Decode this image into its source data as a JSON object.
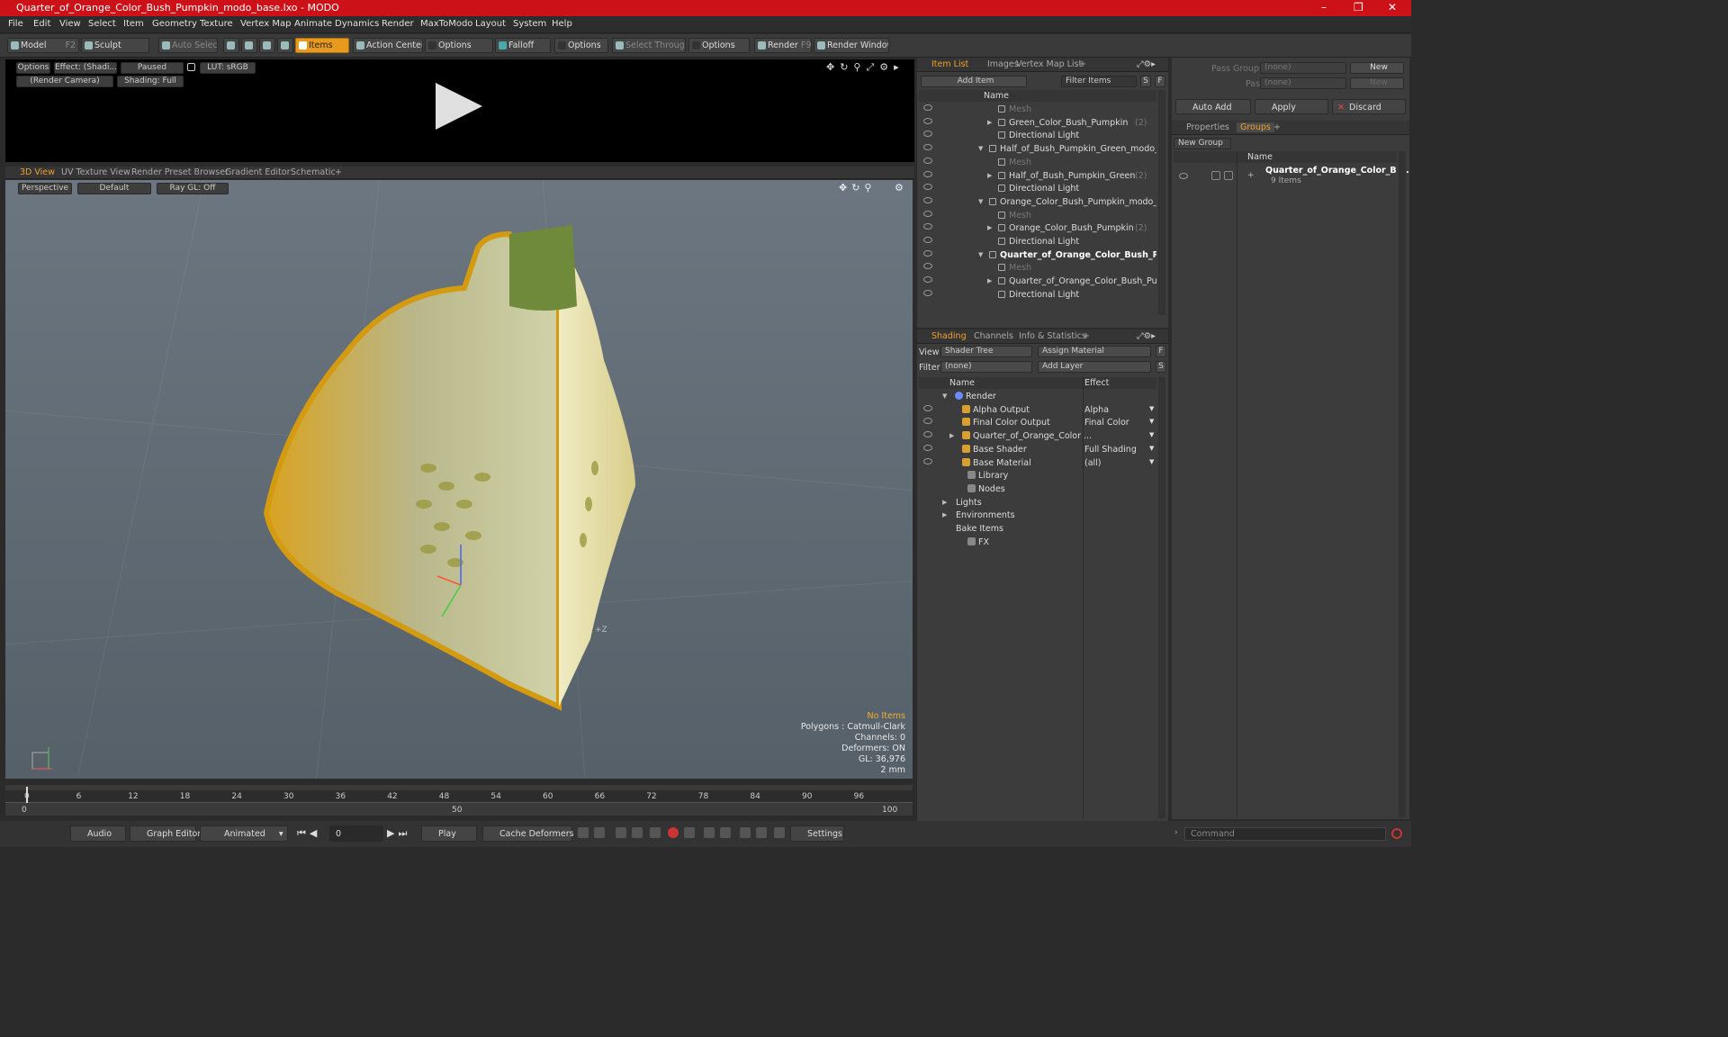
{
  "window": {
    "title": "Quarter_of_Orange_Color_Bush_Pumpkin_modo_base.lxo - MODO",
    "minimize": "–",
    "maximize": "❐",
    "close": "✕"
  },
  "menu": [
    "File",
    "Edit",
    "View",
    "Select",
    "Item",
    "Geometry",
    "Texture",
    "Vertex Map",
    "Animate",
    "Dynamics",
    "Render",
    "MaxToModo",
    "Layout",
    "System",
    "Help"
  ],
  "toolbar": {
    "model": "Model",
    "model_key": "F2",
    "sculpt": "Sculpt",
    "auto_select": "Auto Select",
    "items": "Items",
    "action_center": "Action Center",
    "options1": "Options",
    "falloff": "Falloff",
    "options2": "Options",
    "select_through": "Select Through",
    "options3": "Options",
    "render": "Render",
    "render_key": "F9",
    "render_window": "Render Window"
  },
  "preview": {
    "options": "Options",
    "effect": "Effect: (Shadi...",
    "paused": "Paused",
    "lut": "LUT: sRGB",
    "camera": "(Render Camera)",
    "shading": "Shading: Full"
  },
  "viewport_tabs": [
    "3D View",
    "UV Texture View",
    "Render Preset Browser",
    "Gradient Editor",
    "Schematic",
    "+"
  ],
  "viewport": {
    "perspective": "Perspective",
    "default": "Default",
    "raygl": "Ray GL: Off",
    "axis_label": "+Z"
  },
  "viewport_info": {
    "no_items": "No Items",
    "polygons": "Polygons : Catmull-Clark",
    "channels": "Channels: 0",
    "deformers": "Deformers: ON",
    "gl": "GL: 36,976",
    "size": "2 mm"
  },
  "timeline": {
    "ticks": [
      "0",
      "6",
      "12",
      "18",
      "24",
      "30",
      "36",
      "42",
      "48",
      "54",
      "60",
      "66",
      "72",
      "78",
      "84",
      "90",
      "96"
    ],
    "start": "0",
    "mid": "50",
    "end": "100"
  },
  "bottombar": {
    "audio": "Audio",
    "graph_editor": "Graph Editor",
    "animated": "Animated",
    "frame": "0",
    "play": "Play",
    "cache": "Cache Deformers",
    "settings": "Settings"
  },
  "item_panel": {
    "tabs": [
      "Item List",
      "Images",
      "Vertex Map List",
      "+"
    ],
    "add_item": "Add Item",
    "filter_items": "Filter Items",
    "col_name": "Name",
    "rows": [
      {
        "indent": 3,
        "label": "Mesh",
        "dim": true,
        "tri": ""
      },
      {
        "indent": 3,
        "label": "Green_Color_Bush_Pumpkin",
        "suffix": "(2)",
        "tri": "▶"
      },
      {
        "indent": 3,
        "label": "Directional Light",
        "tri": ""
      },
      {
        "indent": 1,
        "label": "Half_of_Bush_Pumpkin_Green_modo_ba...",
        "tri": "▼"
      },
      {
        "indent": 3,
        "label": "Mesh",
        "dim": true,
        "tri": ""
      },
      {
        "indent": 3,
        "label": "Half_of_Bush_Pumpkin_Green",
        "suffix": "(2)",
        "tri": "▶"
      },
      {
        "indent": 3,
        "label": "Directional Light",
        "tri": ""
      },
      {
        "indent": 1,
        "label": "Orange_Color_Bush_Pumpkin_modo_ba ...",
        "tri": "▼"
      },
      {
        "indent": 3,
        "label": "Mesh",
        "dim": true,
        "tri": ""
      },
      {
        "indent": 3,
        "label": "Orange_Color_Bush_Pumpkin",
        "suffix": "(2)",
        "tri": "▶"
      },
      {
        "indent": 3,
        "label": "Directional Light",
        "tri": ""
      },
      {
        "indent": 1,
        "label": "Quarter_of_Orange_Color_Bush_P...",
        "bold": true,
        "tri": "▼"
      },
      {
        "indent": 3,
        "label": "Mesh",
        "dim": true,
        "tri": ""
      },
      {
        "indent": 3,
        "label": "Quarter_of_Orange_Color_Bush_Pum...",
        "tri": "▶"
      },
      {
        "indent": 3,
        "label": "Directional Light",
        "tri": ""
      }
    ]
  },
  "shading_panel": {
    "tabs": [
      "Shading",
      "Channels",
      "Info & Statistics",
      "+"
    ],
    "view_label": "View",
    "view_value": "Shader Tree",
    "assign_material": "Assign Material",
    "filter_label": "Filter",
    "filter_value": "(none)",
    "add_layer": "Add Layer",
    "col_name": "Name",
    "col_effect": "Effect",
    "rows": [
      {
        "label": "Render",
        "effect": "",
        "level": 0,
        "eye": false,
        "tri": "▼"
      },
      {
        "label": "Alpha Output",
        "effect": "Alpha",
        "level": 1,
        "eye": true,
        "tri": ""
      },
      {
        "label": "Final Color Output",
        "effect": "Final Color",
        "level": 1,
        "eye": true,
        "tri": ""
      },
      {
        "label": "Quarter_of_Orange_Color ...",
        "effect": "",
        "level": 1,
        "eye": true,
        "tri": "▶"
      },
      {
        "label": "Base Shader",
        "effect": "Full Shading",
        "level": 1,
        "eye": true,
        "tri": ""
      },
      {
        "label": "Base Material",
        "effect": "(all)",
        "level": 1,
        "eye": true,
        "tri": ""
      },
      {
        "label": "Library",
        "effect": "",
        "level": 2,
        "eye": false,
        "tri": ""
      },
      {
        "label": "Nodes",
        "effect": "",
        "level": 2,
        "eye": false,
        "tri": ""
      },
      {
        "label": "Lights",
        "effect": "",
        "level": 3,
        "eye": false,
        "tri": "▶"
      },
      {
        "label": "Environments",
        "effect": "",
        "level": 3,
        "eye": false,
        "tri": "▶"
      },
      {
        "label": "Bake Items",
        "effect": "",
        "level": 3,
        "eye": false,
        "tri": ""
      },
      {
        "label": "FX",
        "effect": "",
        "level": 2,
        "eye": false,
        "tri": ""
      }
    ]
  },
  "groups_panel": {
    "pass_groups": "Pass Groups",
    "passes": "Passes",
    "none": "(none)",
    "new": "New",
    "auto_add": "Auto Add",
    "apply": "Apply",
    "discard": "Discard",
    "tabs": [
      "Properties",
      "Groups",
      "+"
    ],
    "new_group": "New Group",
    "col_name": "Name",
    "group_name": "Quarter_of_Orange_Color_B ...",
    "group_count": "9 Items",
    "command": "Command"
  }
}
